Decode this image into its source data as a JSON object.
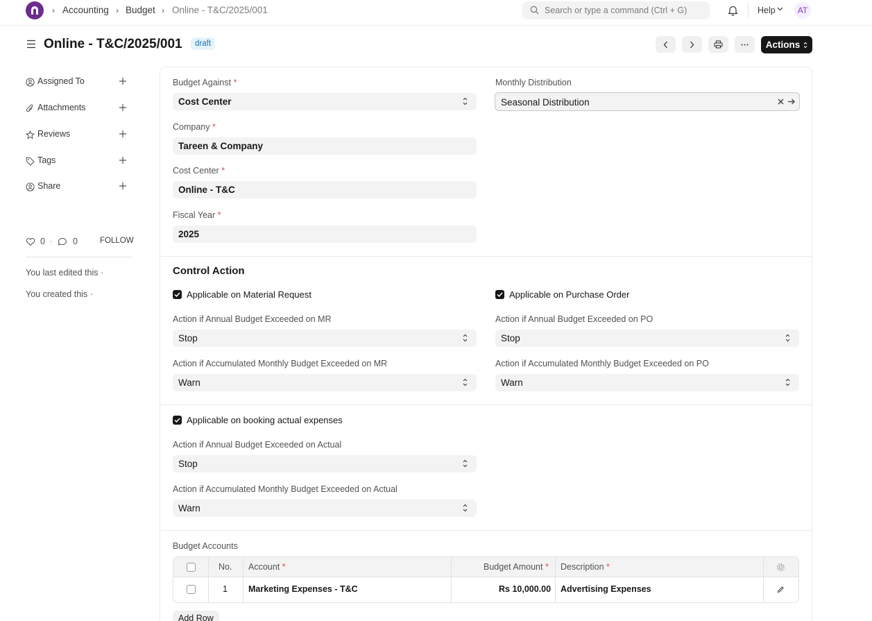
{
  "navbar": {
    "breadcrumbs": [
      "Accounting",
      "Budget",
      "Online - T&C/2025/001"
    ],
    "search_placeholder": "Search or type a command (Ctrl + G)",
    "help_label": "Help",
    "avatar_initials": "AT"
  },
  "header": {
    "title": "Online - T&C/2025/001",
    "status": "draft",
    "actions_label": "Actions"
  },
  "sidebar": {
    "items": [
      {
        "label": "Assigned To",
        "icon": "assign-icon"
      },
      {
        "label": "Attachments",
        "icon": "paperclip-icon"
      },
      {
        "label": "Reviews",
        "icon": "star-icon"
      },
      {
        "label": "Tags",
        "icon": "tag-icon"
      },
      {
        "label": "Share",
        "icon": "share-icon"
      }
    ],
    "likes": "0",
    "comments": "0",
    "follow_label": "FOLLOW",
    "last_edited": "You last edited this ·",
    "created": "You created this ·"
  },
  "form": {
    "budget_against": {
      "label": "Budget Against",
      "value": "Cost Center"
    },
    "monthly_distribution": {
      "label": "Monthly Distribution",
      "value": "Seasonal Distribution"
    },
    "company": {
      "label": "Company",
      "value": "Tareen & Company"
    },
    "cost_center": {
      "label": "Cost Center",
      "value": "Online - T&C"
    },
    "fiscal_year": {
      "label": "Fiscal Year",
      "value": "2025"
    },
    "required_mark": "*"
  },
  "control_action": {
    "title": "Control Action",
    "mr_check": "Applicable on Material Request",
    "po_check": "Applicable on Purchase Order",
    "annual_mr": {
      "label": "Action if Annual Budget Exceeded on MR",
      "value": "Stop"
    },
    "annual_po": {
      "label": "Action if Annual Budget Exceeded on PO",
      "value": "Stop"
    },
    "monthly_mr": {
      "label": "Action if Accumulated Monthly Budget Exceeded on MR",
      "value": "Warn"
    },
    "monthly_po": {
      "label": "Action if Accumulated Monthly Budget Exceeded on PO",
      "value": "Warn"
    },
    "actual_check": "Applicable on booking actual expenses",
    "annual_actual": {
      "label": "Action if Annual Budget Exceeded on Actual",
      "value": "Stop"
    },
    "monthly_actual": {
      "label": "Action if Accumulated Monthly Budget Exceeded on Actual",
      "value": "Warn"
    }
  },
  "budget_accounts": {
    "title": "Budget Accounts",
    "columns": {
      "no": "No.",
      "account": "Account",
      "amount": "Budget Amount",
      "description": "Description"
    },
    "rows": [
      {
        "no": "1",
        "account": "Marketing Expenses - T&C",
        "amount": "Rs 10,000.00",
        "description": "Advertising Expenses"
      }
    ],
    "add_row_label": "Add Row"
  }
}
